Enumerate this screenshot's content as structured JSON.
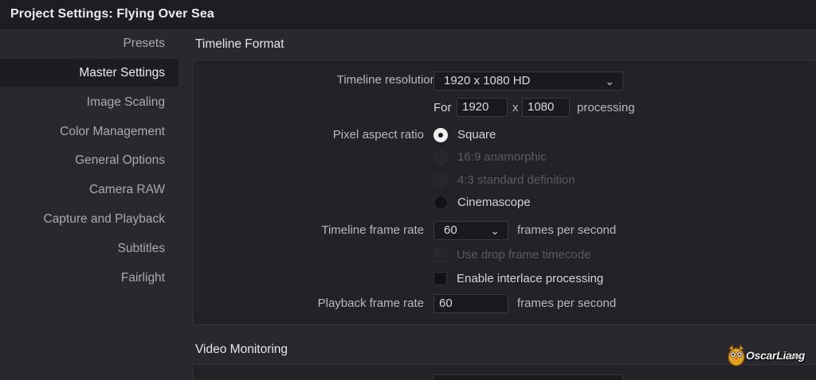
{
  "window": {
    "title": "Project Settings:  Flying Over Sea"
  },
  "sidebar": {
    "items": [
      {
        "label": "Presets"
      },
      {
        "label": "Master Settings"
      },
      {
        "label": "Image Scaling"
      },
      {
        "label": "Color Management"
      },
      {
        "label": "General Options"
      },
      {
        "label": "Camera RAW"
      },
      {
        "label": "Capture and Playback"
      },
      {
        "label": "Subtitles"
      },
      {
        "label": "Fairlight"
      }
    ],
    "active": "Master Settings"
  },
  "timeline_format": {
    "heading": "Timeline Format",
    "resolution": {
      "label": "Timeline resolution",
      "value": "1920 x 1080 HD"
    },
    "processing": {
      "prefix": "For",
      "width": "1920",
      "separator": "x",
      "height": "1080",
      "suffix": "processing"
    },
    "pixel_aspect": {
      "label": "Pixel aspect ratio",
      "options": [
        {
          "label": "Square",
          "state": "selected"
        },
        {
          "label": "16:9 anamorphic",
          "state": "disabled"
        },
        {
          "label": "4:3 standard definition",
          "state": "disabled"
        },
        {
          "label": "Cinemascope",
          "state": "unselected"
        }
      ]
    },
    "frame_rate": {
      "label": "Timeline frame rate",
      "value": "60",
      "suffix": "frames per second"
    },
    "drop_frame": {
      "label": "Use drop frame timecode",
      "checked": false,
      "disabled": true
    },
    "interlace": {
      "label": "Enable interlace processing",
      "checked": false,
      "disabled": false
    },
    "playback_rate": {
      "label": "Playback frame rate",
      "value": "60",
      "suffix": "frames per second"
    }
  },
  "video_monitoring": {
    "heading": "Video Monitoring"
  },
  "watermark": {
    "text": "OscarLiang",
    "domain": ".com"
  }
}
